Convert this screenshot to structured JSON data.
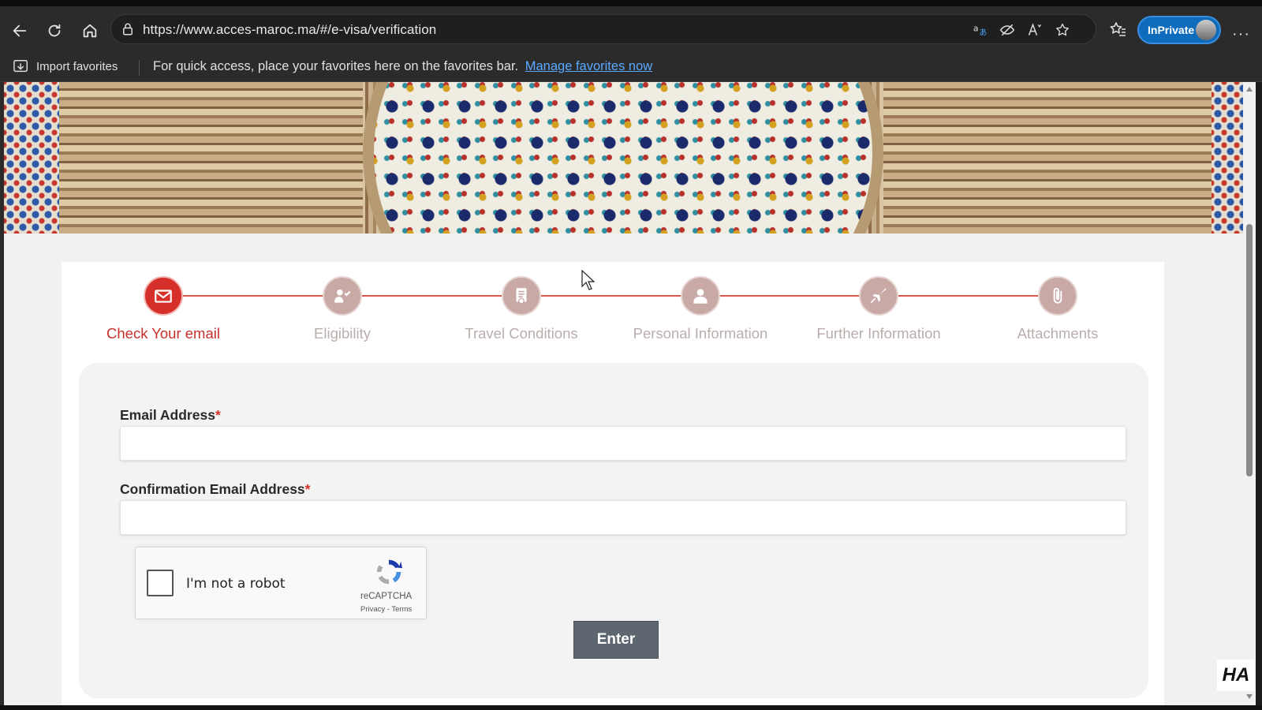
{
  "browser": {
    "url": "https://www.acces-maroc.ma/#/e-visa/verification",
    "inprivate_label": "InPrivate",
    "more_label": "···"
  },
  "favorites_bar": {
    "import_label": "Import favorites",
    "hint_text": "For quick access, place your favorites here on the favorites bar.",
    "manage_link": "Manage favorites now"
  },
  "stepper": {
    "steps": [
      {
        "label": "Check Your email",
        "icon": "envelope-icon",
        "active": true
      },
      {
        "label": "Eligibility",
        "icon": "person-check-icon",
        "active": false
      },
      {
        "label": "Travel Conditions",
        "icon": "document-badge-icon",
        "active": false
      },
      {
        "label": "Personal Information",
        "icon": "person-icon",
        "active": false
      },
      {
        "label": "Further Information",
        "icon": "airplane-icon",
        "active": false
      },
      {
        "label": "Attachments",
        "icon": "paperclip-icon",
        "active": false
      }
    ],
    "active_color": "#d7302b",
    "inactive_color": "#c8a9a6"
  },
  "form": {
    "email_label": "Email Address",
    "email_value": "",
    "confirm_email_label": "Confirmation Email Address",
    "confirm_email_value": "",
    "required_mark": "*",
    "recaptcha": {
      "label": "I'm not a robot",
      "brand": "reCAPTCHA",
      "terms": "Privacy - Terms",
      "checked": false
    },
    "submit_label": "Enter"
  },
  "watermark": "HA"
}
